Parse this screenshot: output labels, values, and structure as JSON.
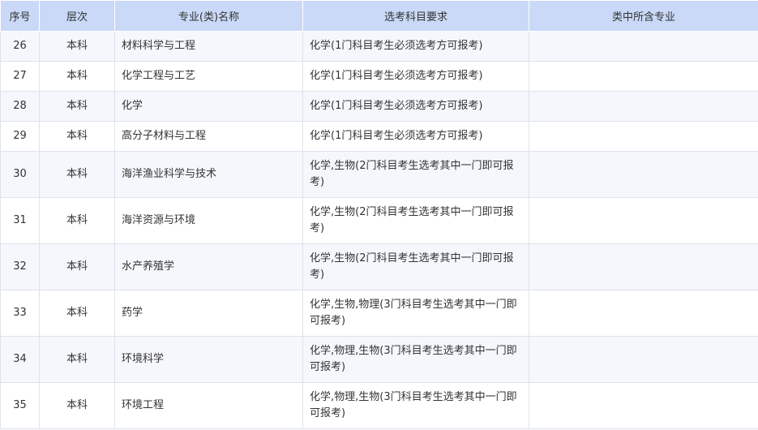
{
  "headers": {
    "no": "序号",
    "level": "层次",
    "major": "专业(类)名称",
    "subjects": "选考科目要求",
    "included": "类中所含专业"
  },
  "rows": [
    {
      "no": "26",
      "level": "本科",
      "major": "材料科学与工程",
      "subjects": "化学(1门科目考生必须选考方可报考)",
      "included": ""
    },
    {
      "no": "27",
      "level": "本科",
      "major": "化学工程与工艺",
      "subjects": "化学(1门科目考生必须选考方可报考)",
      "included": ""
    },
    {
      "no": "28",
      "level": "本科",
      "major": "化学",
      "subjects": "化学(1门科目考生必须选考方可报考)",
      "included": ""
    },
    {
      "no": "29",
      "level": "本科",
      "major": "高分子材料与工程",
      "subjects": "化学(1门科目考生必须选考方可报考)",
      "included": ""
    },
    {
      "no": "30",
      "level": "本科",
      "major": "海洋渔业科学与技术",
      "subjects": "化学,生物(2门科目考生选考其中一门即可报考)",
      "included": ""
    },
    {
      "no": "31",
      "level": "本科",
      "major": "海洋资源与环境",
      "subjects": "化学,生物(2门科目考生选考其中一门即可报考)",
      "included": ""
    },
    {
      "no": "32",
      "level": "本科",
      "major": "水产养殖学",
      "subjects": "化学,生物(2门科目考生选考其中一门即可报考)",
      "included": ""
    },
    {
      "no": "33",
      "level": "本科",
      "major": "药学",
      "subjects": "化学,生物,物理(3门科目考生选考其中一门即可报考)",
      "included": ""
    },
    {
      "no": "34",
      "level": "本科",
      "major": "环境科学",
      "subjects": "化学,物理,生物(3门科目考生选考其中一门即可报考)",
      "included": ""
    },
    {
      "no": "35",
      "level": "本科",
      "major": "环境工程",
      "subjects": "化学,物理,生物(3门科目考生选考其中一门即可报考)",
      "included": ""
    }
  ]
}
